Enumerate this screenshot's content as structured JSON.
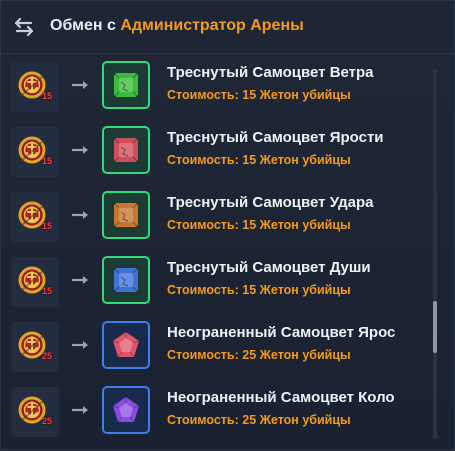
{
  "header": {
    "title_prefix": "Обмен с",
    "partner": "Администратор Арены"
  },
  "currency": {
    "name": "Жетон убийцы",
    "icon": "assassin-token-icon"
  },
  "items": [
    {
      "name": "Треснутый Самоцвет Ветра",
      "cost_label": "Стоимость: 15 Жетон убийцы",
      "qty": "15",
      "gem": "cracked",
      "color": "#3dbb3c",
      "frame": "green"
    },
    {
      "name": "Треснутый Самоцвет Ярости",
      "cost_label": "Стоимость: 15 Жетон убийцы",
      "qty": "15",
      "gem": "cracked",
      "color": "#cf4d5c",
      "frame": "green"
    },
    {
      "name": "Треснутый Самоцвет Удара",
      "cost_label": "Стоимость: 15 Жетон убийцы",
      "qty": "15",
      "gem": "cracked",
      "color": "#c7772f",
      "frame": "green"
    },
    {
      "name": "Треснутый Самоцвет Души",
      "cost_label": "Стоимость: 15 Жетон убийцы",
      "qty": "15",
      "gem": "cracked",
      "color": "#3f73d6",
      "frame": "green"
    },
    {
      "name": "Неограненный Самоцвет Ярос",
      "cost_label": "Стоимость: 25 Жетон убийцы",
      "qty": "25",
      "gem": "rough",
      "color": "#e0556a",
      "frame": "blue"
    },
    {
      "name": "Неограненный Самоцвет Коло",
      "cost_label": "Стоимость: 25 Жетон убийцы",
      "qty": "25",
      "gem": "rough",
      "color": "#8a4be0",
      "frame": "blue"
    }
  ]
}
